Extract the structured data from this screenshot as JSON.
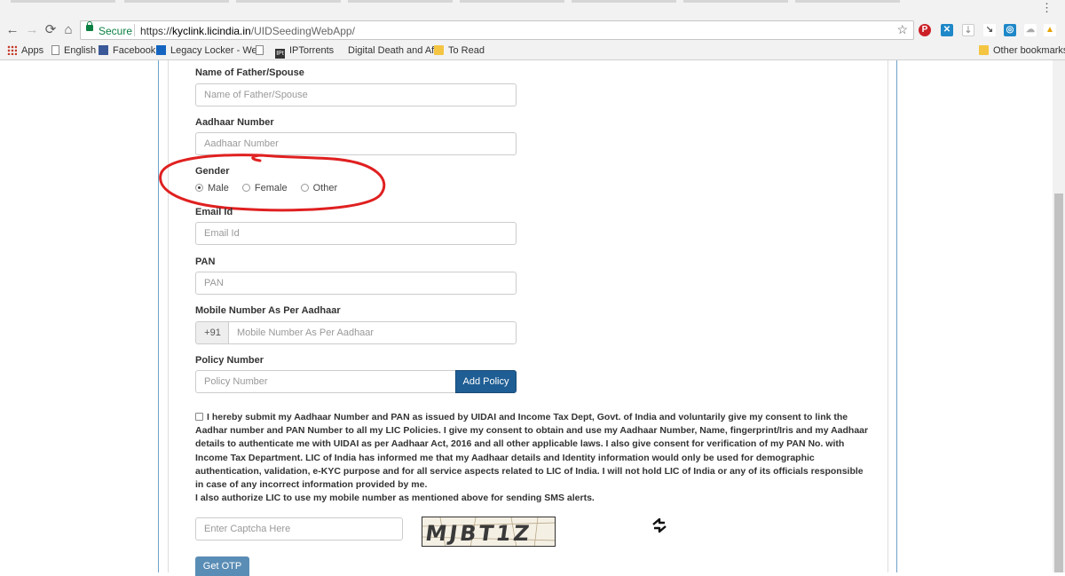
{
  "browser": {
    "secure_label": "Secure",
    "url_scheme": "https://",
    "url_host": "kyclink.licindia.in",
    "url_path": "/UIDSeedingWebApp/",
    "menu_dots": "⋮",
    "bookmarks": [
      {
        "label": "Apps",
        "icon": "apps-grid-icon"
      },
      {
        "label": "English",
        "icon": "page-icon"
      },
      {
        "label": "Facebook",
        "icon": "facebook-icon"
      },
      {
        "label": "Legacy Locker - Welc",
        "icon": "legacy-locker-icon"
      },
      {
        "label": "",
        "icon": "page-icon"
      },
      {
        "label": "IPTorrents",
        "icon": "iptorrents-icon"
      },
      {
        "label": "Digital Death and Aft",
        "icon": "page-icon"
      },
      {
        "label": "To Read",
        "icon": "folder-icon"
      }
    ],
    "other_bookmarks": "Other bookmarks"
  },
  "form": {
    "father_label": "Name of Father/Spouse",
    "father_placeholder": "Name of Father/Spouse",
    "aadhaar_label": "Aadhaar Number",
    "aadhaar_placeholder": "Aadhaar Number",
    "gender_label": "Gender",
    "gender_options": [
      {
        "label": "Male",
        "checked": true
      },
      {
        "label": "Female",
        "checked": false
      },
      {
        "label": "Other",
        "checked": false
      }
    ],
    "email_label": "Email Id",
    "email_placeholder": "Email Id",
    "pan_label": "PAN",
    "pan_placeholder": "PAN",
    "mobile_label": "Mobile Number As Per Aadhaar",
    "mobile_prefix": "+91",
    "mobile_placeholder": "Mobile Number As Per Aadhaar",
    "policy_label": "Policy Number",
    "policy_placeholder": "Policy Number",
    "add_policy_button": "Add Policy",
    "consent_text": "I hereby submit my Aadhaar Number and PAN as issued by UIDAI and Income Tax Dept, Govt. of India and voluntarily give my consent to link the Aadhar number and PAN Number to all my LIC Policies. I give my consent to obtain and use my Aadhaar Number, Name, fingerprint/Iris and my Aadhaar details to authenticate me with UIDAI as per Aadhaar Act, 2016 and all other applicable laws. I also give consent for verification of my PAN No. with Income Tax Department. LIC of India has informed me that my Aadhaar details and Identity information would only be used for demographic authentication, validation, e-KYC purpose and for all service aspects related to LIC of India. I will not hold LIC of India or any of its officials responsible in case of any incorrect information provided by me.",
    "sms_text": "I also authorize LIC to use my mobile number as mentioned above for sending SMS alerts.",
    "captcha_placeholder": "Enter Captcha Here",
    "captcha_text": "MJBT1Z",
    "get_otp_button": "Get OTP"
  },
  "colors": {
    "primary_button": "#1f5e94",
    "otp_button": "#5a8db5",
    "annotation": "#e02020",
    "secure_green": "#0b8043"
  }
}
